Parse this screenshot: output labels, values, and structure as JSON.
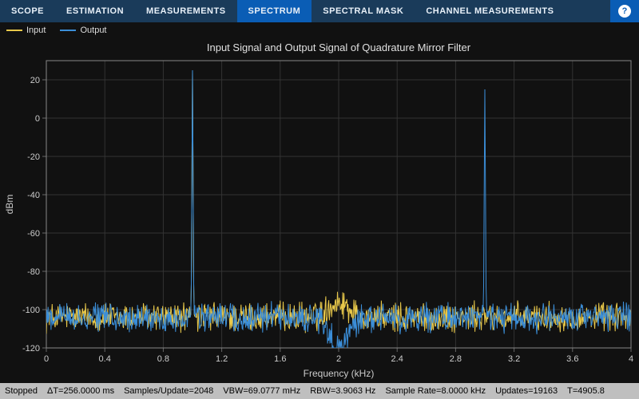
{
  "tabs": {
    "items": [
      {
        "label": "SCOPE"
      },
      {
        "label": "ESTIMATION"
      },
      {
        "label": "MEASUREMENTS"
      },
      {
        "label": "SPECTRUM",
        "active": true
      },
      {
        "label": "SPECTRAL MASK"
      },
      {
        "label": "CHANNEL MEASUREMENTS"
      }
    ]
  },
  "legend": {
    "items": [
      {
        "label": "Input",
        "color": "#e8c84a"
      },
      {
        "label": "Output",
        "color": "#3b8ed8"
      }
    ]
  },
  "chart": {
    "title": "Input Signal and Output Signal of Quadrature Mirror Filter",
    "xlabel": "Frequency (kHz)",
    "ylabel": "dBm",
    "xlim": [
      0,
      4
    ],
    "ylim": [
      -120,
      30
    ],
    "xticks": [
      0,
      0.4,
      0.8,
      1.2,
      1.6,
      2,
      2.4,
      2.8,
      3.2,
      3.6,
      4
    ],
    "yticks": [
      -120,
      -100,
      -80,
      -60,
      -40,
      -20,
      0,
      20
    ]
  },
  "status": {
    "state": "Stopped",
    "deltaT": "ΔT=256.0000 ms",
    "samples": "Samples/Update=2048",
    "vbw": "VBW=69.0777 mHz",
    "rbw": "RBW=3.9063 Hz",
    "rate": "Sample Rate=8.0000 kHz",
    "updates": "Updates=19163",
    "t": "T=4905.8"
  },
  "chart_data": {
    "type": "line",
    "title": "Input Signal and Output Signal of Quadrature Mirror Filter",
    "xlabel": "Frequency (kHz)",
    "ylabel": "dBm",
    "xlim": [
      0,
      4
    ],
    "ylim": [
      -120,
      30
    ],
    "x_step": 0.004,
    "series": [
      {
        "name": "Input",
        "description": "Noise floor near -104 dBm with a single tonal peak at 1.0 kHz rising to approximately +25 dBm.",
        "noise_floor_dBm": -104,
        "noise_pp_dBm": 6,
        "peaks": [
          {
            "freq_kHz": 1.0,
            "level_dBm": 25
          }
        ]
      },
      {
        "name": "Output",
        "description": "Noise floor near -104 dBm; peak at 1.0 kHz (~+25 dBm), peak at 3.0 kHz (~+15 dBm); deep symmetric notch at 2.0 kHz reaching about -120 dBm; slight bump near 2 kHz on input only.",
        "noise_floor_dBm": -104,
        "noise_pp_dBm": 6,
        "peaks": [
          {
            "freq_kHz": 1.0,
            "level_dBm": 25
          },
          {
            "freq_kHz": 3.0,
            "level_dBm": 15
          }
        ],
        "notch": {
          "freq_kHz": 2.0,
          "depth_dBm": -120,
          "half_width_kHz": 0.15
        }
      }
    ]
  }
}
